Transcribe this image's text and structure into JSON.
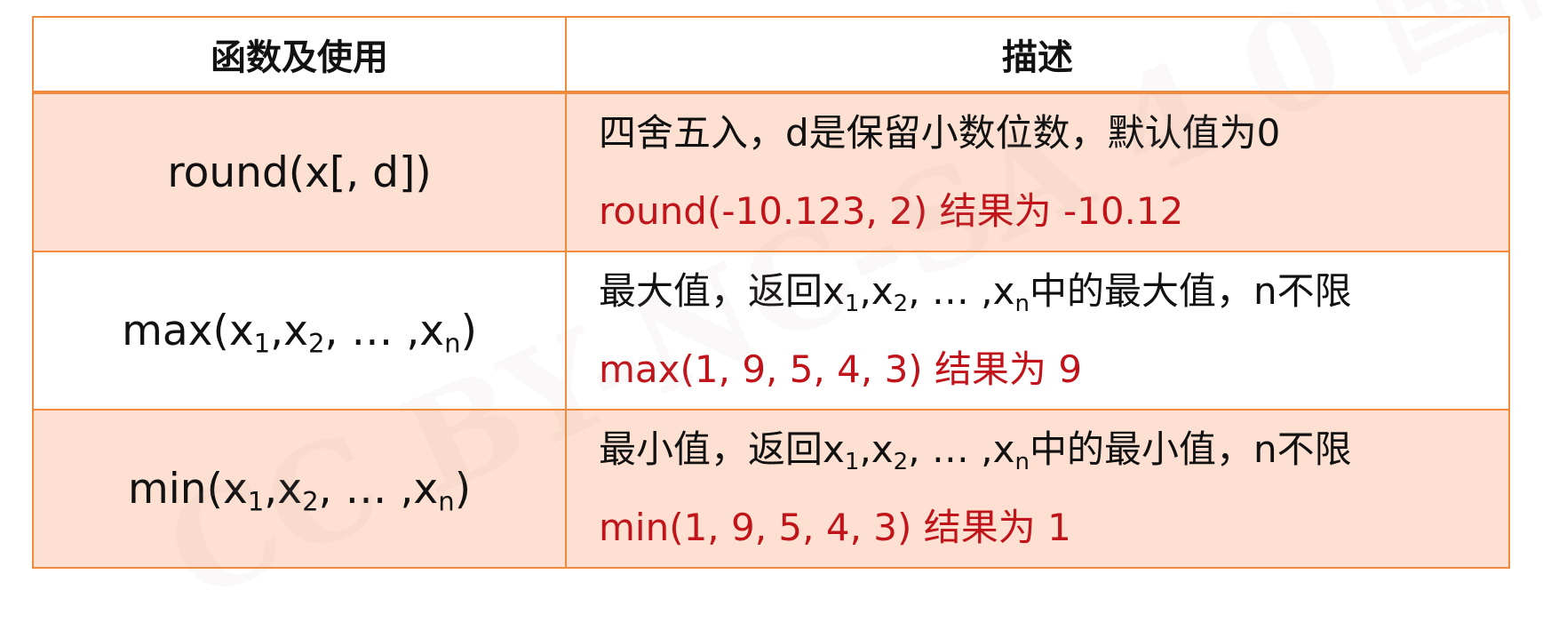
{
  "watermark": "CC BY-NC-SA 4.0 国际",
  "table": {
    "header": {
      "function_col": "函数及使用",
      "description_col": "描述"
    },
    "rows": [
      {
        "func": "round(x[, d])",
        "description": "四舍五入，d是保留小数位数，默认值为0",
        "example": "round(-10.123, 2) 结果为 -10.12"
      },
      {
        "func_name": "max",
        "func_args": [
          "x",
          "1",
          "x",
          "2",
          "x",
          "n"
        ],
        "desc_before": "最大值，返回",
        "desc_after": "中的最大值，n不限",
        "example": "max(1, 9, 5, 4, 3) 结果为 9"
      },
      {
        "func_name": "min",
        "func_args": [
          "x",
          "1",
          "x",
          "2",
          "x",
          "n"
        ],
        "desc_before": "最小值，返回",
        "desc_after": "中的最小值，n不限",
        "example": "min(1, 9, 5, 4, 3) 结果为 1"
      }
    ],
    "seq_parts": {
      "open": "(",
      "comma": ",",
      "comma_space": ", ",
      "ellipsis": "…",
      "close": ")"
    }
  },
  "colors": {
    "border": "#f08a3c",
    "row_shade": "#fde0d1",
    "example_text": "#c0141a"
  }
}
